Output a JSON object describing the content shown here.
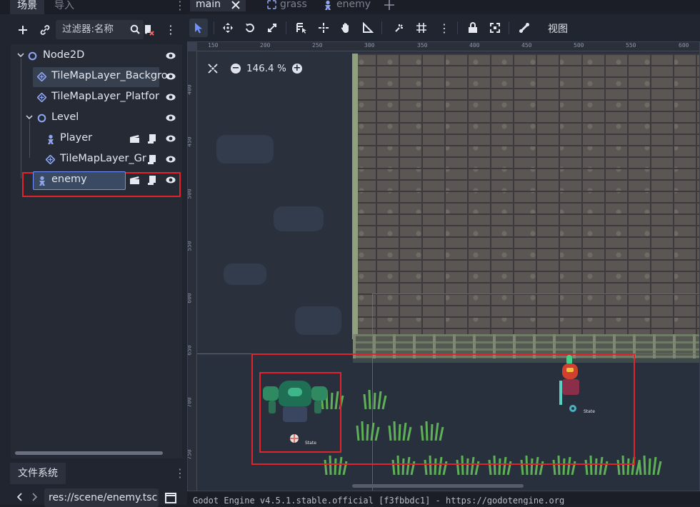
{
  "left_dock": {
    "tabs": [
      {
        "label": "场景"
      },
      {
        "label": "导入"
      }
    ],
    "filter_placeholder": "过滤器:名称",
    "tree": [
      {
        "label": "Node2D"
      },
      {
        "label": "TileMapLayer_Backgro"
      },
      {
        "label": "TileMapLayer_Platfor"
      },
      {
        "label": "Level"
      },
      {
        "label": "Player"
      },
      {
        "label": "TileMapLayer_Gr"
      },
      {
        "label": "enemy"
      }
    ]
  },
  "filesystem": {
    "tab_label": "文件系统",
    "path": "res://scene/enemy.tsc"
  },
  "editor": {
    "scene_tabs": [
      {
        "label": "main"
      },
      {
        "label": "grass"
      },
      {
        "label": "enemy"
      }
    ],
    "view_label": "视图",
    "zoom": "146.4 %",
    "ruler_top": [
      "150",
      "200",
      "250",
      "300",
      "350",
      "400",
      "450",
      "500",
      "550",
      "600"
    ],
    "ruler_left": [
      "400",
      "450",
      "500",
      "550",
      "600",
      "650",
      "700",
      "750"
    ],
    "sprite_label_1": "State",
    "sprite_label_2": "State",
    "status": "Godot Engine v4.5.1.stable.official [f3fbbdc1] - https://godotengine.org"
  },
  "colors": {
    "highlight": "#e0242b",
    "accent": "#6f8fff",
    "panel": "#252a35"
  }
}
